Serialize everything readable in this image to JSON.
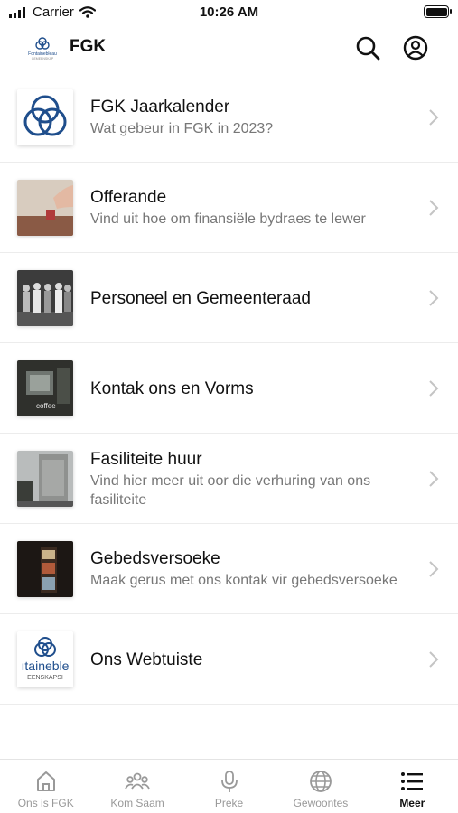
{
  "status_bar": {
    "carrier": "Carrier",
    "time": "10:26 AM"
  },
  "header": {
    "title": "FGK",
    "logo_text": "Fontainebleau",
    "logo_subtext": "GEMEENSKAP"
  },
  "items": [
    {
      "title": "FGK Jaarkalender",
      "subtitle": "Wat gebeur in FGK in 2023?",
      "thumbnail": "fgk-logo-mark"
    },
    {
      "title": "Offerande",
      "subtitle": "Vind uit hoe om finansiële bydraes te lewer",
      "thumbnail": "offering-photo"
    },
    {
      "title": "Personeel en Gemeenteraad",
      "subtitle": "",
      "thumbnail": "staff-group-photo"
    },
    {
      "title": "Kontak ons en Vorms",
      "subtitle": "",
      "thumbnail": "coffee-shop-photo",
      "thumbnail_text": "coffee"
    },
    {
      "title": "Fasiliteite huur",
      "subtitle": "Vind hier meer uit oor die verhuring van ons fasiliteite",
      "thumbnail": "building-photo"
    },
    {
      "title": "Gebedsversoeke",
      "subtitle": "Maak gerus met ons kontak vir gebedsversoeke",
      "thumbnail": "window-photo"
    },
    {
      "title": "Ons Webtuiste",
      "subtitle": "",
      "thumbnail": "fontainebleau-logo",
      "thumbnail_text": "ıtaineble",
      "thumbnail_subtext": "EENSKAPSI"
    }
  ],
  "tabs": [
    {
      "label": "Ons is FGK",
      "icon": "home-icon",
      "active": false
    },
    {
      "label": "Kom Saam",
      "icon": "group-icon",
      "active": false
    },
    {
      "label": "Preke",
      "icon": "microphone-icon",
      "active": false
    },
    {
      "label": "Gewoontes",
      "icon": "globe-icon",
      "active": false
    },
    {
      "label": "Meer",
      "icon": "list-icon",
      "active": true
    }
  ],
  "colors": {
    "brand": "#1f4e8c",
    "text": "#111111",
    "subtext": "#777777",
    "tab_inactive": "#999999"
  }
}
